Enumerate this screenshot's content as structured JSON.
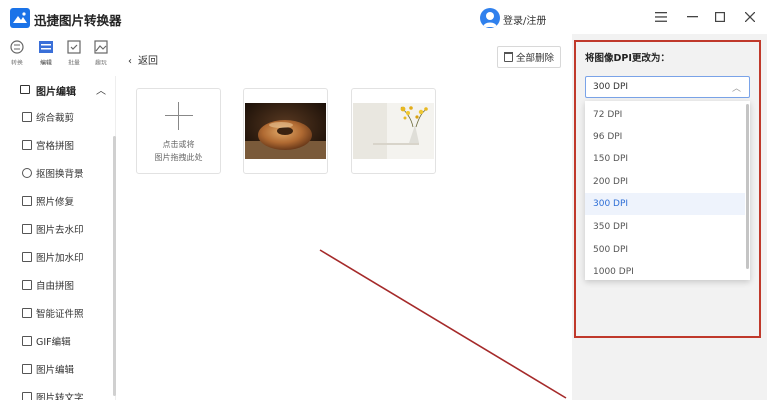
{
  "app": {
    "title": "迅捷图片转换器",
    "login": "登录/注册",
    "window_controls": [
      "menu-icon",
      "minimize-icon",
      "maximize-icon",
      "close-icon"
    ]
  },
  "iconbar": {
    "tabs": [
      {
        "label": "转换",
        "icon": "convert-icon",
        "active": false
      },
      {
        "label": "编辑",
        "icon": "edit-icon",
        "active": true
      },
      {
        "label": "批量",
        "icon": "batch-icon",
        "active": false
      },
      {
        "label": "趣玩",
        "icon": "fun-icon",
        "active": false
      }
    ]
  },
  "sidebar": {
    "section_title": "图片编辑",
    "items": [
      {
        "label": "综合裁剪"
      },
      {
        "label": "宫格拼图"
      },
      {
        "label": "抠图换背景"
      },
      {
        "label": "照片修复"
      },
      {
        "label": "图片去水印"
      },
      {
        "label": "图片加水印"
      },
      {
        "label": "自由拼图"
      },
      {
        "label": "智能证件照"
      },
      {
        "label": "GIF编辑"
      },
      {
        "label": "图片编辑"
      },
      {
        "label": "图片转文字"
      }
    ]
  },
  "main": {
    "back": "返回",
    "delete_all": "全部删除",
    "add_hint_line1": "点击或将",
    "add_hint_line2": "图片拖拽此处",
    "thumbnails": [
      "donut-photo",
      "flowers-photo"
    ]
  },
  "dpi_panel": {
    "label": "将图像DPI更改为：",
    "selected": "300 DPI",
    "options": [
      "72 DPI",
      "96 DPI",
      "150 DPI",
      "200 DPI",
      "300 DPI",
      "350 DPI",
      "500 DPI",
      "1000 DPI"
    ],
    "selected_index": 4
  },
  "colors": {
    "accent": "#2f6fd6",
    "annotation": "#c0392b",
    "panel_bg": "#f2f2f2"
  }
}
